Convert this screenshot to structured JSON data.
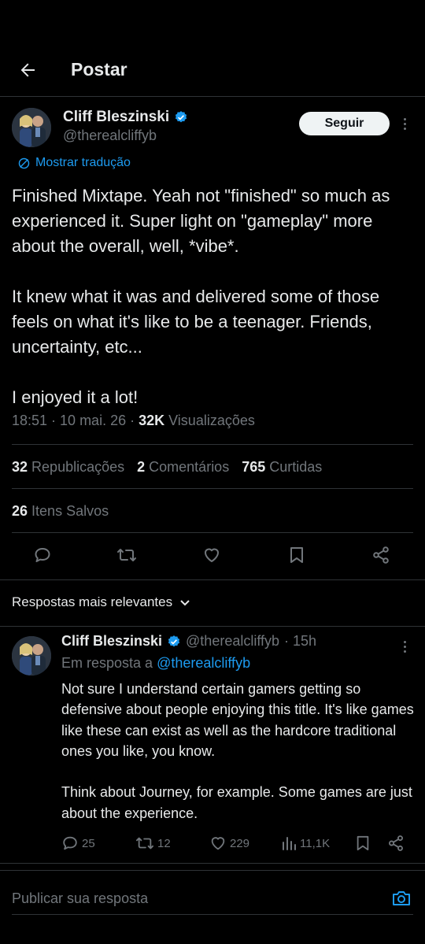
{
  "header": {
    "title": "Postar"
  },
  "tweet": {
    "author_name": "Cliff Bleszinski",
    "author_handle": "@therealcliffyb",
    "follow_label": "Seguir",
    "translate_label": "Mostrar tradução",
    "text": "Finished Mixtape. Yeah not \"finished\" so much as experienced it. Super light on \"gameplay\" more about the overall, well, *vibe*.\n\nIt knew what it was and delivered some of those feels on what it's like to be a teenager. Friends, uncertainty, etc...\n\nI enjoyed it a lot!",
    "time": "18:51 · 10 mai. 26 ·",
    "views_count": "32K",
    "views_label": "Visualizações",
    "reposts_count": "32",
    "reposts_label": "Republicações",
    "comments_count": "2",
    "comments_label": "Comentários",
    "likes_count": "765",
    "likes_label": "Curtidas",
    "saves_count": "26",
    "saves_label": "Itens Salvos"
  },
  "sort": {
    "label": "Respostas mais relevantes"
  },
  "reply": {
    "author_name": "Cliff Bleszinski",
    "author_handle": "@therealcliffyb",
    "age": "· 15h",
    "in_reply_prefix": "Em resposta a",
    "in_reply_handle": "@therealcliffyb",
    "text": "Not sure I understand certain gamers getting so defensive about people enjoying this title. It's like games like these can exist as well as the hardcore traditional ones you like, you know.\n\nThink about Journey, for example. Some games are just about the experience.",
    "replies": "25",
    "reposts": "12",
    "likes": "229",
    "views": "11,1K"
  },
  "compose": {
    "placeholder": "Publicar sua resposta"
  },
  "colors": {
    "background": "#000000",
    "text": "#e7e9ea",
    "muted": "#71767b",
    "accent": "#1d9bf0",
    "divider": "#2f3336"
  },
  "icons": [
    "back-arrow-icon",
    "verified-badge-icon",
    "more-icon",
    "translate-icon",
    "reply-icon",
    "repost-icon",
    "like-icon",
    "bookmark-icon",
    "share-icon",
    "chevron-down-icon",
    "views-icon",
    "camera-icon"
  ]
}
